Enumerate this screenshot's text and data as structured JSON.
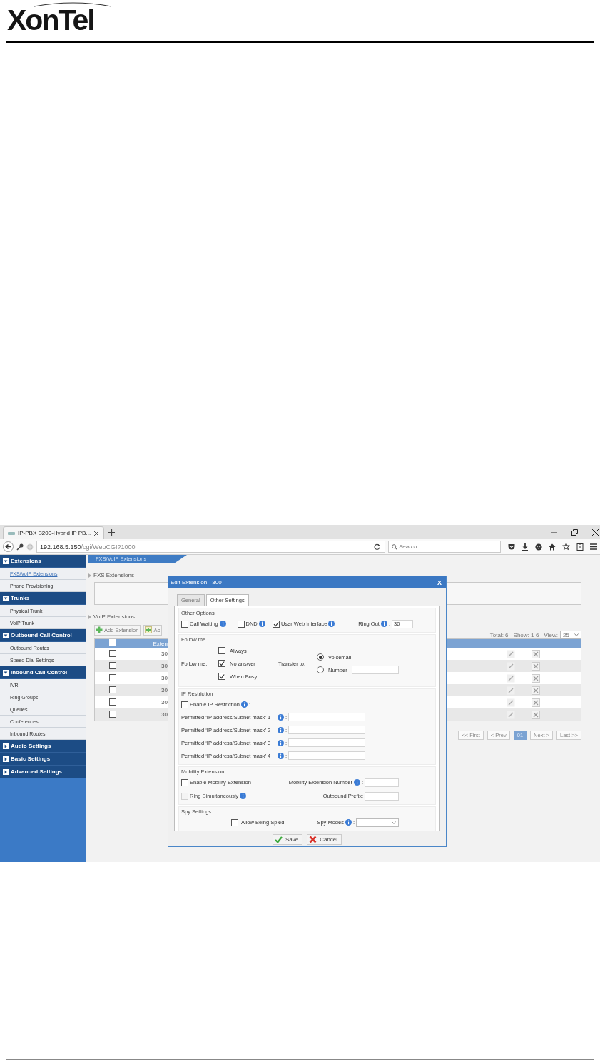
{
  "logo": {
    "text": "XonTel"
  },
  "browser": {
    "tab": {
      "title": "IP-PBX S200-Hybrid IP PB..."
    },
    "address": {
      "host": "192.168.5.150",
      "path": "/cgi/WebCGI?1000"
    },
    "search": {
      "placeholder": "Search"
    }
  },
  "sidebar": {
    "groups": [
      {
        "label": "Extensions",
        "expanded": true,
        "items": [
          {
            "label": "FXS/VoIP Extensions",
            "selected": true
          },
          {
            "label": "Phone Provisioning",
            "selected": false
          }
        ]
      },
      {
        "label": "Trunks",
        "expanded": true,
        "items": [
          {
            "label": "Physical Trunk",
            "selected": false
          },
          {
            "label": "VoIP Trunk",
            "selected": false
          }
        ]
      },
      {
        "label": "Outbound Call Control",
        "expanded": true,
        "items": [
          {
            "label": "Outbound Routes",
            "selected": false
          },
          {
            "label": "Speed Dial Settings",
            "selected": false
          }
        ]
      },
      {
        "label": "Inbound Call Control",
        "expanded": true,
        "items": [
          {
            "label": "IVR",
            "selected": false
          },
          {
            "label": "Ring Groups",
            "selected": false
          },
          {
            "label": "Queues",
            "selected": false
          },
          {
            "label": "Conferences",
            "selected": false
          },
          {
            "label": "Inbound Routes",
            "selected": false
          }
        ]
      },
      {
        "label": "Audio Settings",
        "expanded": false
      },
      {
        "label": "Basic Settings",
        "expanded": false
      },
      {
        "label": "Advanced Settings",
        "expanded": false
      }
    ]
  },
  "breadcrumb": {
    "label": "FXS/VoIP Extensions"
  },
  "fxs_extensions": {
    "title": "FXS Extensions"
  },
  "voip_extensions": {
    "title": "VoIP Extensions",
    "toolbar": [
      {
        "label": "Add Extension",
        "kind": "add"
      },
      {
        "label": "Ac",
        "kind": "batch"
      }
    ],
    "summary": {
      "total": "Total: 6",
      "show": "Show: 1-6",
      "view_label": "View:",
      "view_value": "25"
    },
    "table": {
      "columns": [
        "Exten"
      ],
      "header_checked": false,
      "rows": [
        {
          "checked": false,
          "extension": "30"
        },
        {
          "checked": false,
          "extension": "30"
        },
        {
          "checked": false,
          "extension": "30"
        },
        {
          "checked": false,
          "extension": "30"
        },
        {
          "checked": false,
          "extension": "30"
        },
        {
          "checked": false,
          "extension": "30"
        }
      ]
    },
    "pagination": [
      {
        "label": "<< First",
        "selected": false
      },
      {
        "label": "< Prev",
        "selected": false
      },
      {
        "label": "01",
        "selected": true
      },
      {
        "label": "Next >",
        "selected": false
      },
      {
        "label": "Last >>",
        "selected": false
      }
    ]
  },
  "dialog": {
    "title": "Edit Extension - 300",
    "close": "X",
    "tabs": [
      {
        "label": "General",
        "selected": false
      },
      {
        "label": "Other Settings",
        "selected": true
      }
    ],
    "other_options": {
      "title": "Other Options",
      "options": [
        {
          "label": "Call Waiting",
          "checked": false
        },
        {
          "label": "DND",
          "checked": false
        },
        {
          "label": "User Web Interface",
          "checked": true
        }
      ],
      "ring_out": {
        "label": "Ring Out",
        "suffix": ":",
        "value": "30"
      }
    },
    "follow_me": {
      "title": "Follow me",
      "label": "Follow me:",
      "conditions": [
        {
          "label": "Always",
          "checked": false
        },
        {
          "label": "No answer",
          "checked": true
        },
        {
          "label": "When Busy",
          "checked": true
        }
      ],
      "transfer_label": "Transfer to:",
      "destinations": [
        {
          "label": "Voicemail",
          "selected": true
        },
        {
          "label": "Number",
          "selected": false
        }
      ]
    },
    "ip_restriction": {
      "title": "IP Restriction",
      "enable": {
        "label": "Enable IP Restriction",
        "suffix": ":",
        "checked": false
      },
      "fields": [
        {
          "label": "Permitted ‘IP address/Subnet mask’ 1",
          "suffix": ":"
        },
        {
          "label": "Permitted ‘IP address/Subnet mask’ 2",
          "suffix": ":"
        },
        {
          "label": "Permitted ‘IP address/Subnet mask’ 3",
          "suffix": ":"
        },
        {
          "label": "Permitted ‘IP address/Subnet mask’ 4",
          "suffix": ":"
        }
      ]
    },
    "mobility": {
      "title": "Mobility Extension",
      "enable": {
        "label": "Enable Mobility Extension",
        "checked": false
      },
      "number": {
        "label": "Mobility Extension Number",
        "suffix": ":"
      },
      "ring_simultaneously": {
        "label": "Ring Simultaneously",
        "checked": false,
        "disabled": true
      },
      "prefix": {
        "label": "Outbound Prefix:"
      }
    },
    "spy": {
      "title": "Spy Settings",
      "allow": {
        "label": "Allow Being Spied",
        "checked": false
      },
      "modes": {
        "label": "Spy Modes",
        "suffix": ":",
        "value": "------"
      }
    },
    "buttons": [
      {
        "label": "Save",
        "kind": "save"
      },
      {
        "label": "Cancel",
        "kind": "cancel"
      }
    ]
  }
}
